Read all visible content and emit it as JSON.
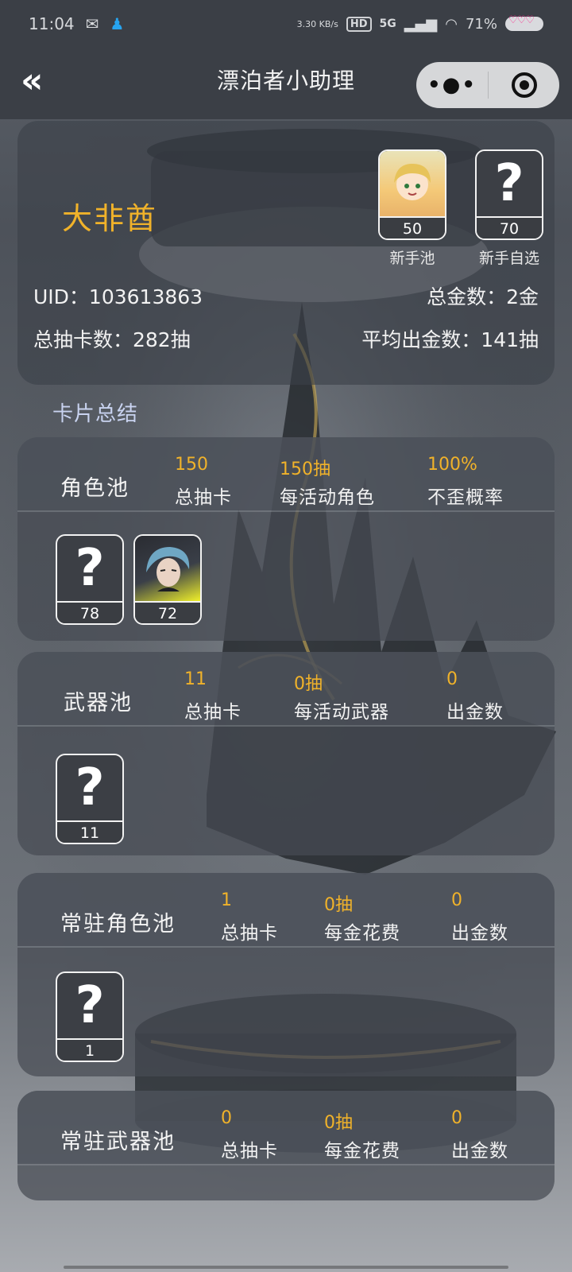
{
  "status_bar": {
    "time": "11:04",
    "speed": "3.30 KB/s",
    "hd_label": "HD",
    "network": "5G",
    "battery": "71%"
  },
  "nav": {
    "title": "漂泊者小助理",
    "back_icon": "double-chevron-left-icon",
    "more_icon": "more-dots-icon",
    "close_icon": "target-circle-icon"
  },
  "summary": {
    "user_name": "大非酋",
    "newbie_pools": [
      {
        "caption": "新手池",
        "count": "50",
        "has_avatar": true
      },
      {
        "caption": "新手自选",
        "count": "70",
        "has_avatar": false
      }
    ],
    "uid_label": "UID：103613863",
    "total_gold_label": "总金数：2金",
    "total_pulls_label": "总抽卡数：282抽",
    "avg_gold_label": "平均出金数：141抽"
  },
  "section_title": "卡片总结",
  "pools": [
    {
      "name": "角色池",
      "stats": [
        {
          "value": "150",
          "label": "总抽卡"
        },
        {
          "value": "150抽",
          "label": "每活动角色"
        },
        {
          "value": "100%",
          "label": "不歪概率"
        }
      ],
      "items": [
        {
          "count": "78",
          "has_avatar": false
        },
        {
          "count": "72",
          "has_avatar": true
        }
      ]
    },
    {
      "name": "武器池",
      "stats": [
        {
          "value": "11",
          "label": "总抽卡"
        },
        {
          "value": "0抽",
          "label": "每活动武器"
        },
        {
          "value": "0",
          "label": "出金数"
        }
      ],
      "items": [
        {
          "count": "11",
          "has_avatar": false
        }
      ]
    },
    {
      "name": "常驻角色池",
      "stats": [
        {
          "value": "1",
          "label": "总抽卡"
        },
        {
          "value": "0抽",
          "label": "每金花费"
        },
        {
          "value": "0",
          "label": "出金数"
        }
      ],
      "items": [
        {
          "count": "1",
          "has_avatar": false
        }
      ]
    },
    {
      "name": "常驻武器池",
      "stats": [
        {
          "value": "0",
          "label": "总抽卡"
        },
        {
          "value": "0抽",
          "label": "每金花费"
        },
        {
          "value": "0",
          "label": "出金数"
        }
      ],
      "items": []
    }
  ],
  "colors": {
    "accent_gold": "#f0b22a",
    "bar_bg": "#3b3f46",
    "section_title": "#c9d3f0"
  }
}
